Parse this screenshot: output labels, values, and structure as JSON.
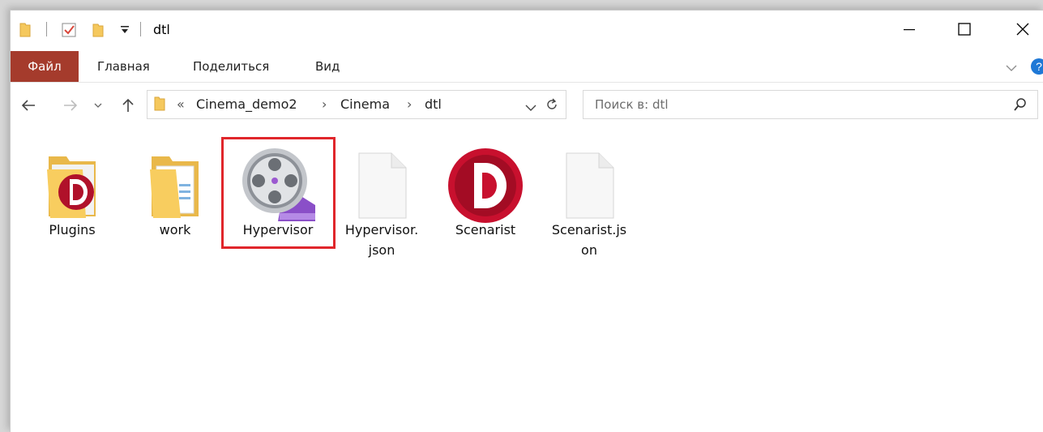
{
  "window": {
    "title": "dtl"
  },
  "titlebar": {
    "qa_icons": [
      "folder-icon",
      "properties-icon",
      "new-folder-icon",
      "customize-qa-icon"
    ],
    "controls": [
      "minimize-icon",
      "maximize-icon",
      "close-icon"
    ]
  },
  "ribbon": {
    "tabs": [
      {
        "label": "Файл"
      },
      {
        "label": "Главная"
      },
      {
        "label": "Поделиться"
      },
      {
        "label": "Вид"
      }
    ]
  },
  "address": {
    "overflow": "«",
    "path": [
      "Cinema_demo2",
      "Cinema",
      "dtl"
    ],
    "separator": "›"
  },
  "search": {
    "placeholder": "Поиск в: dtl"
  },
  "files": [
    {
      "name": "Plugins",
      "icon": "plugins-folder-icon"
    },
    {
      "name": "work",
      "icon": "folder-icon"
    },
    {
      "name": "Hypervisor",
      "icon": "hypervisor-app-icon",
      "highlighted": true
    },
    {
      "name": "Hypervisor.\njson",
      "line1": "Hypervisor.",
      "line2": "json",
      "icon": "file-icon"
    },
    {
      "name": "Scenarist",
      "icon": "scenarist-app-icon"
    },
    {
      "name": "Scenarist.json",
      "line1": "Scenarist.js",
      "line2": "on",
      "icon": "file-icon"
    }
  ],
  "colors": {
    "file_tab": "#a53b2c",
    "highlight": "#e0262b",
    "folder": "#f5c85d",
    "app_red": "#c8102e",
    "purple": "#8a4fc8"
  }
}
